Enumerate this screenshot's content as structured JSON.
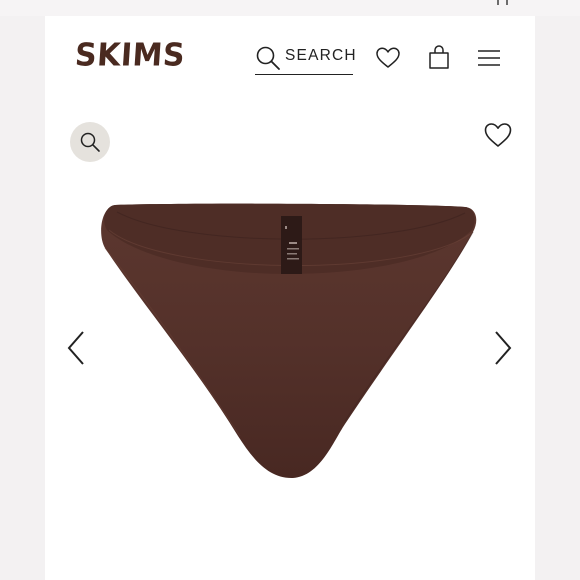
{
  "brand": {
    "name": "SKIMS",
    "color": "#4a2a20"
  },
  "header": {
    "search_label": "SEARCH",
    "search_icon": "search-icon",
    "wishlist_icon": "heart-icon",
    "bag_icon": "shopping-bag-icon",
    "menu_icon": "hamburger-menu-icon"
  },
  "product": {
    "image": "brown-bikini-bottom-photo",
    "color": "#54312a",
    "actions": {
      "zoom_icon": "magnifier-icon",
      "favorite_icon": "heart-icon"
    }
  },
  "carousel": {
    "prev_icon": "chevron-left-icon",
    "next_icon": "chevron-right-icon"
  }
}
